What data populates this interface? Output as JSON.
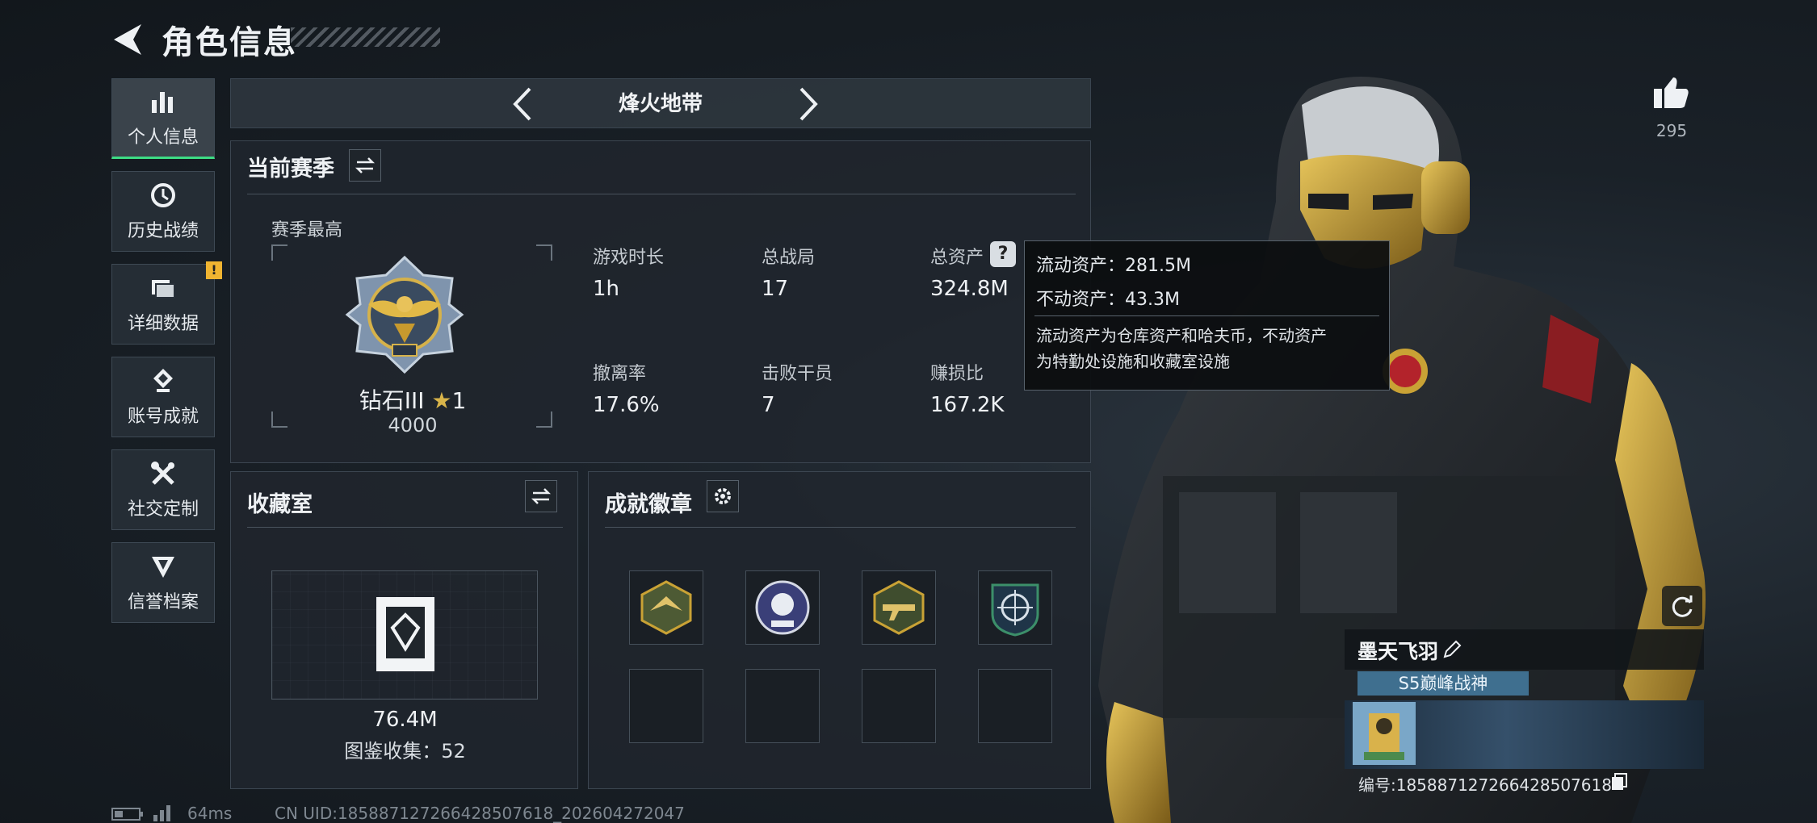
{
  "header": {
    "title": "角色信息"
  },
  "sidebar": {
    "items": [
      {
        "label": "个人信息",
        "icon": "bar-chart-icon",
        "active": true
      },
      {
        "label": "历史战绩",
        "icon": "history-icon"
      },
      {
        "label": "详细数据",
        "icon": "folder-icon",
        "alert": "!"
      },
      {
        "label": "账号成就",
        "icon": "achievement-icon"
      },
      {
        "label": "社交定制",
        "icon": "tools-icon"
      },
      {
        "label": "信誉档案",
        "icon": "reputation-icon"
      }
    ]
  },
  "mode": {
    "title": "烽火地带"
  },
  "season": {
    "title": "当前赛季",
    "best_label": "赛季最高",
    "rank_name": "钻石III",
    "rank_stars": "1",
    "rank_points": "4000",
    "stats": {
      "play_time": {
        "label": "游戏时长",
        "value": "1h"
      },
      "total_matches": {
        "label": "总战局",
        "value": "17"
      },
      "total_assets": {
        "label": "总资产",
        "value": "324.8M"
      },
      "extract_rate": {
        "label": "撤离率",
        "value": "17.6%"
      },
      "kills": {
        "label": "击败干员",
        "value": "7"
      },
      "profit_ratio": {
        "label": "赚损比",
        "value": "167.2K"
      }
    }
  },
  "tooltip": {
    "liquid": "流动资产：281.5M",
    "fixed": "不动资产：43.3M",
    "note_line1": "流动资产为仓库资产和哈夫币，不动资产",
    "note_line2": "为特勤处设施和收藏室设施"
  },
  "collection": {
    "title": "收藏室",
    "value": "76.4M",
    "count_text": "图鉴收集：52"
  },
  "achievements": {
    "title": "成就徽章"
  },
  "likes": {
    "count": "295"
  },
  "player": {
    "name": "墨天飞羽",
    "title": "S5巅峰战神",
    "id_text": "编号:18588712726642850​7618"
  },
  "footer": {
    "ping": "64ms",
    "uid": "CN UID:18588712726642850​7618_202604272047"
  },
  "colors": {
    "accent_green": "#3ddc84",
    "alert_yellow": "#f0b431",
    "gold": "#c9a235"
  }
}
